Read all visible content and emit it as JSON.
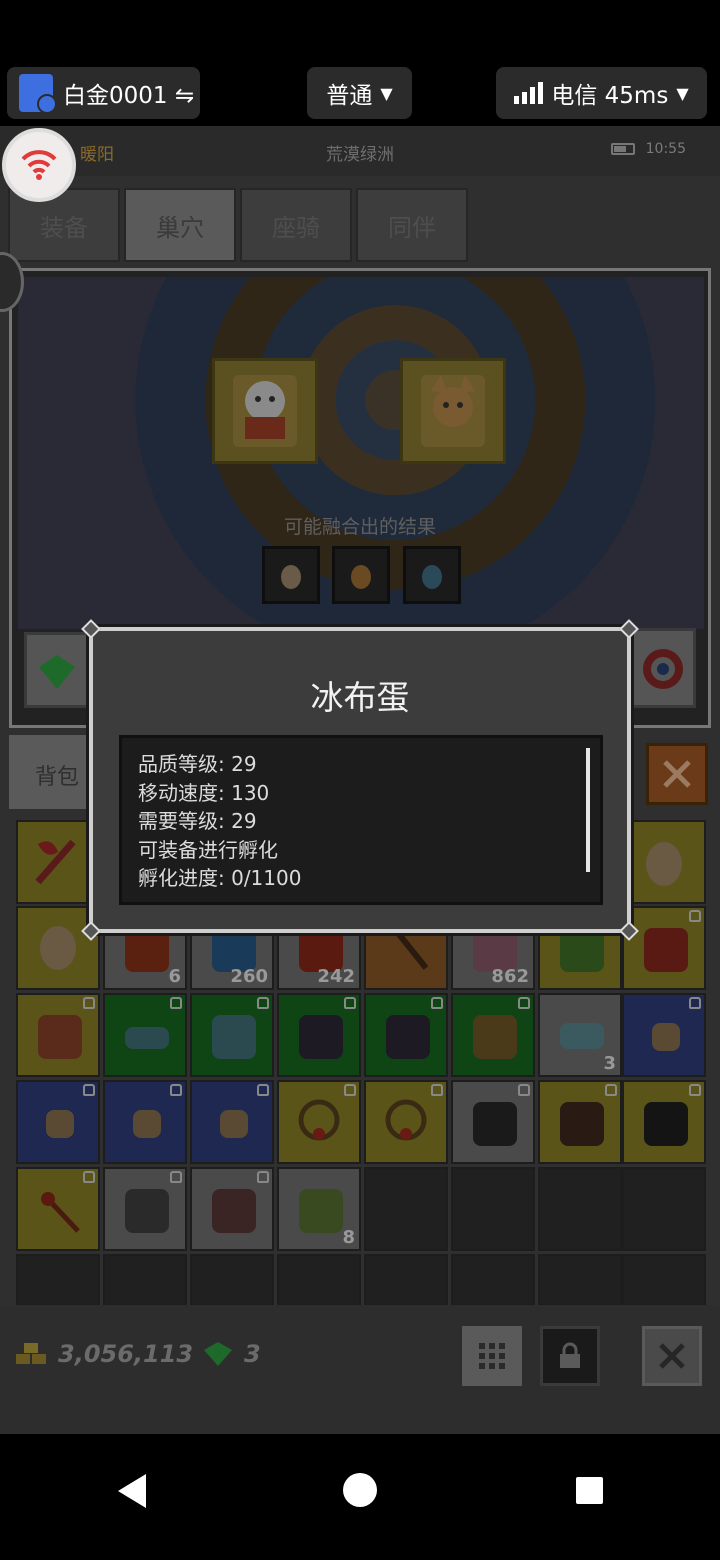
{
  "topbar": {
    "account_label": "白金0001 ⇋",
    "mode_label": "普通",
    "network_label": "电信 45ms"
  },
  "game_status": {
    "location_left": "暖阳",
    "location_title": "荒漠绿洲",
    "time": "10:55"
  },
  "tabs": [
    {
      "label": "装备"
    },
    {
      "label": "巢穴"
    },
    {
      "label": "座骑"
    },
    {
      "label": "同伴"
    }
  ],
  "nest": {
    "results_label": "可能融合出的结果"
  },
  "bag": {
    "tab_label": "背包"
  },
  "inventory": {
    "quantities": [
      "6",
      "260",
      "242",
      "862",
      "3",
      "8"
    ]
  },
  "footer": {
    "gold": "3,056,113",
    "gems": "3"
  },
  "dialog": {
    "title": "冰布蛋",
    "lines": [
      "品质等级: 29",
      "移动速度: 130",
      "需要等级: 29",
      "可装备进行孵化",
      "孵化进度: 0/1100"
    ]
  },
  "colors": {
    "slot_yellow": "#5b5419",
    "slot_green": "#0f4414",
    "slot_blue": "#1e2850",
    "dialog_border": "#cfcfcf",
    "close_orange": "#6b3a18"
  }
}
